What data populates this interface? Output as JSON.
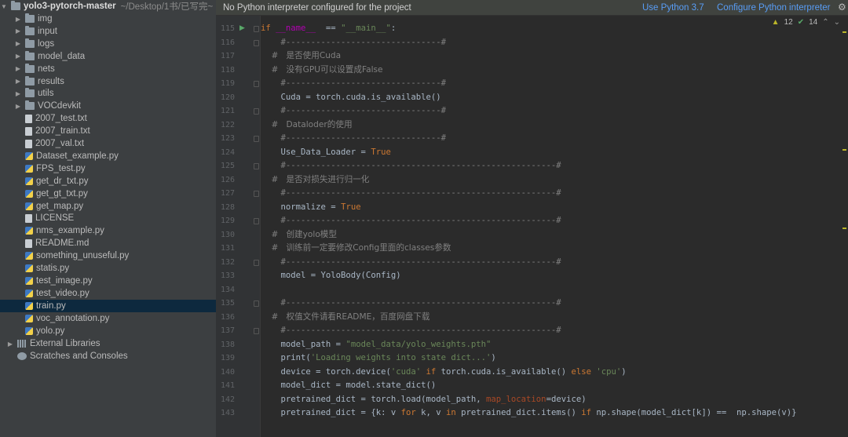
{
  "sidebar": {
    "root": {
      "name": "yolo3-pytorch-master",
      "path": "~/Desktop/1书/已写完~"
    },
    "items": [
      {
        "label": "img",
        "type": "folder"
      },
      {
        "label": "input",
        "type": "folder"
      },
      {
        "label": "logs",
        "type": "folder"
      },
      {
        "label": "model_data",
        "type": "folder"
      },
      {
        "label": "nets",
        "type": "folder"
      },
      {
        "label": "results",
        "type": "folder"
      },
      {
        "label": "utils",
        "type": "folder"
      },
      {
        "label": "VOCdevkit",
        "type": "folder"
      },
      {
        "label": "2007_test.txt",
        "type": "file"
      },
      {
        "label": "2007_train.txt",
        "type": "file"
      },
      {
        "label": "2007_val.txt",
        "type": "file"
      },
      {
        "label": "Dataset_example.py",
        "type": "py"
      },
      {
        "label": "FPS_test.py",
        "type": "py"
      },
      {
        "label": "get_dr_txt.py",
        "type": "py"
      },
      {
        "label": "get_gt_txt.py",
        "type": "py"
      },
      {
        "label": "get_map.py",
        "type": "py"
      },
      {
        "label": "LICENSE",
        "type": "file"
      },
      {
        "label": "nms_example.py",
        "type": "py"
      },
      {
        "label": "README.md",
        "type": "file"
      },
      {
        "label": "something_unuseful.py",
        "type": "py"
      },
      {
        "label": "statis.py",
        "type": "py"
      },
      {
        "label": "test_image.py",
        "type": "py"
      },
      {
        "label": "test_video.py",
        "type": "py"
      },
      {
        "label": "train.py",
        "type": "py",
        "selected": true
      },
      {
        "label": "voc_annotation.py",
        "type": "py"
      },
      {
        "label": "yolo.py",
        "type": "py"
      }
    ],
    "external_libraries": "External Libraries",
    "scratches": "Scratches and Consoles"
  },
  "banner": {
    "message": "No Python interpreter configured for the project",
    "use_python": "Use Python 3.7",
    "configure": "Configure Python interpreter"
  },
  "inspections": {
    "warnings": "12",
    "ok": "14"
  },
  "editor": {
    "lines": [
      {
        "n": "115",
        "t": [
          [
            "kw",
            "if "
          ],
          [
            "dunder",
            "__name__"
          ],
          [
            "",
            "  == "
          ],
          [
            "str",
            "\"__main__\""
          ],
          [
            "",
            ":"
          ]
        ]
      },
      {
        "n": "116",
        "t": [
          [
            "com",
            "    #-------------------------------#"
          ]
        ]
      },
      {
        "n": "117",
        "t": [
          [
            "com",
            "    #   是否使用Cuda"
          ]
        ]
      },
      {
        "n": "118",
        "t": [
          [
            "com",
            "    #   没有GPU可以设置成False"
          ]
        ]
      },
      {
        "n": "119",
        "t": [
          [
            "com",
            "    #-------------------------------#"
          ]
        ]
      },
      {
        "n": "120",
        "t": [
          [
            "",
            "    Cuda = torch.cuda.is_available()"
          ]
        ]
      },
      {
        "n": "121",
        "t": [
          [
            "com",
            "    #-------------------------------#"
          ]
        ]
      },
      {
        "n": "122",
        "t": [
          [
            "com",
            "    #   Dataloder的使用"
          ]
        ]
      },
      {
        "n": "123",
        "t": [
          [
            "com",
            "    #-------------------------------#"
          ]
        ]
      },
      {
        "n": "124",
        "t": [
          [
            "",
            "    Use_Data_Loader = "
          ],
          [
            "kw",
            "True"
          ]
        ]
      },
      {
        "n": "125",
        "t": [
          [
            "com",
            "    #------------------------------------------------------#"
          ]
        ]
      },
      {
        "n": "126",
        "t": [
          [
            "com",
            "    #   是否对损失进行归一化"
          ]
        ]
      },
      {
        "n": "127",
        "t": [
          [
            "com",
            "    #------------------------------------------------------#"
          ]
        ]
      },
      {
        "n": "128",
        "t": [
          [
            "",
            "    normalize = "
          ],
          [
            "kw",
            "True"
          ]
        ]
      },
      {
        "n": "129",
        "t": [
          [
            "com",
            "    #------------------------------------------------------#"
          ]
        ]
      },
      {
        "n": "130",
        "t": [
          [
            "com",
            "    #   创建yolo模型"
          ]
        ]
      },
      {
        "n": "131",
        "t": [
          [
            "com",
            "    #   训练前一定要修改Config里面的classes参数"
          ]
        ]
      },
      {
        "n": "132",
        "t": [
          [
            "com",
            "    #------------------------------------------------------#"
          ]
        ]
      },
      {
        "n": "133",
        "t": [
          [
            "",
            "    model = YoloBody(Config)"
          ]
        ]
      },
      {
        "n": "134",
        "t": [
          [
            "",
            ""
          ]
        ]
      },
      {
        "n": "135",
        "t": [
          [
            "com",
            "    #------------------------------------------------------#"
          ]
        ]
      },
      {
        "n": "136",
        "t": [
          [
            "com",
            "    #   权值文件请看README，百度网盘下载"
          ]
        ]
      },
      {
        "n": "137",
        "t": [
          [
            "com",
            "    #------------------------------------------------------#"
          ]
        ]
      },
      {
        "n": "138",
        "t": [
          [
            "",
            "    model_path = "
          ],
          [
            "str",
            "\"model_data/yolo_weights.pth\""
          ]
        ]
      },
      {
        "n": "139",
        "t": [
          [
            "",
            "    print("
          ],
          [
            "str",
            "'Loading weights into state dict...'"
          ],
          [
            "",
            ")"
          ]
        ]
      },
      {
        "n": "140",
        "t": [
          [
            "",
            "    device = torch.device("
          ],
          [
            "str",
            "'cuda'"
          ],
          [
            "kw",
            " if "
          ],
          [
            "",
            "torch.cuda.is_available()"
          ],
          [
            "kw",
            " else "
          ],
          [
            "str",
            "'cpu'"
          ],
          [
            "",
            ")"
          ]
        ]
      },
      {
        "n": "141",
        "t": [
          [
            "",
            "    model_dict = model.state_dict()"
          ]
        ]
      },
      {
        "n": "142",
        "t": [
          [
            "",
            "    pretrained_dict = torch.load(model_path, "
          ],
          [
            "prm",
            "map_location"
          ],
          [
            "",
            "=device)"
          ]
        ]
      },
      {
        "n": "143",
        "t": [
          [
            "",
            "    pretrained_dict = {k: v "
          ],
          [
            "kw",
            "for"
          ],
          [
            "",
            " k, v "
          ],
          [
            "kw",
            "in"
          ],
          [
            "",
            " pretrained_dict.items() "
          ],
          [
            "kw",
            "if"
          ],
          [
            "",
            " np.shape(model_dict[k]) ==  np.shape(v)}"
          ]
        ]
      }
    ]
  }
}
